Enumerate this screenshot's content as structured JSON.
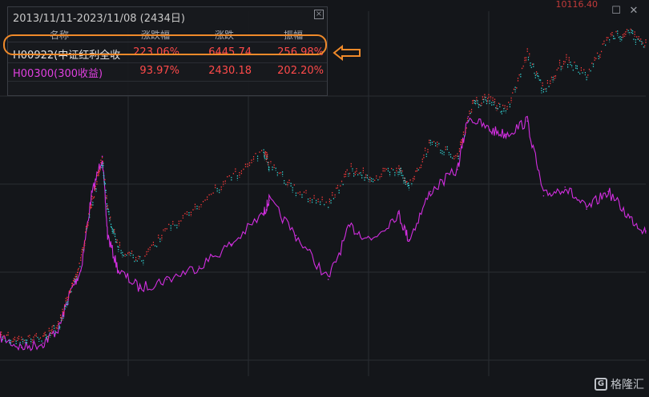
{
  "panel": {
    "title": "2013/11/11-2023/11/08 (2434日)",
    "close_icon": "close-x-icon",
    "headers": {
      "name": "名称",
      "change_pct": "涨跌幅",
      "change_pts": "涨跌",
      "amplitude": "振幅"
    },
    "rows": [
      {
        "name": "H00922(中证红利全收",
        "change_pct": "223.06%",
        "change_pts": "6445.74",
        "amplitude": "256.98%",
        "name_color": "#e6e6e6",
        "value_color": "#ff4a4a"
      },
      {
        "name": "H00300(300收益)",
        "change_pct": "93.97%",
        "change_pts": "2430.18",
        "amplitude": "202.20%",
        "name_color": "#e040e0",
        "value_color": "#ff4a4a"
      }
    ]
  },
  "chart_top_value": "10116.40",
  "window_icons": [
    "maximize-icon",
    "close-icon"
  ],
  "watermark": {
    "logo_letter": "G",
    "text": "格隆汇"
  },
  "colors": {
    "background": "#14161a",
    "grid": "#2a2d33",
    "dividend_up": "#ff3b3b",
    "dividend_down": "#32d0d0",
    "csi300": "#d22ee0",
    "highlight": "#f08a2a"
  },
  "chart_data": {
    "type": "line",
    "x_range": [
      "2013/11/11",
      "2023/11/08"
    ],
    "ylim": [
      2000,
      10300
    ],
    "grid": true,
    "series": [
      {
        "name": "H00922(中证红利全收",
        "style": "dotted-candles",
        "x": [
          "2013-11",
          "2014-03",
          "2014-07",
          "2014-10",
          "2014-12",
          "2015-02",
          "2015-04",
          "2015-06",
          "2015-07",
          "2015-09",
          "2016-01",
          "2016-06",
          "2016-12",
          "2017-06",
          "2017-12",
          "2018-01",
          "2018-06",
          "2018-12",
          "2019-04",
          "2019-08",
          "2020-01",
          "2020-03",
          "2020-07",
          "2020-12",
          "2021-03",
          "2021-06",
          "2021-09",
          "2022-01",
          "2022-04",
          "2022-08",
          "2022-12",
          "2023-04",
          "2023-08",
          "2023-11"
        ],
        "values": [
          2890,
          2800,
          2860,
          3150,
          3900,
          4600,
          5900,
          6900,
          5800,
          4900,
          4600,
          5300,
          5900,
          6500,
          7100,
          6800,
          6200,
          5900,
          6700,
          6500,
          6700,
          6300,
          7300,
          7000,
          8200,
          8300,
          8000,
          9300,
          8500,
          9200,
          8800,
          9700,
          9800,
          9500
        ]
      },
      {
        "name": "H00300(300收益)",
        "style": "line",
        "x": [
          "2013-11",
          "2014-03",
          "2014-07",
          "2014-10",
          "2014-12",
          "2015-02",
          "2015-04",
          "2015-06",
          "2015-07",
          "2015-09",
          "2016-01",
          "2016-06",
          "2016-12",
          "2017-06",
          "2017-12",
          "2018-01",
          "2018-06",
          "2018-12",
          "2019-04",
          "2019-08",
          "2020-01",
          "2020-03",
          "2020-07",
          "2020-12",
          "2021-02",
          "2021-06",
          "2021-09",
          "2022-01",
          "2022-04",
          "2022-08",
          "2022-12",
          "2023-04",
          "2023-08",
          "2023-11"
        ],
        "values": [
          2890,
          2650,
          2750,
          3100,
          3900,
          4400,
          6100,
          7000,
          5200,
          4400,
          4000,
          4200,
          4500,
          5000,
          5700,
          6000,
          5200,
          4200,
          5400,
          5100,
          5700,
          5100,
          6200,
          6700,
          7900,
          7600,
          7500,
          7800,
          6100,
          6300,
          5800,
          6200,
          5600,
          5300
        ]
      }
    ]
  }
}
